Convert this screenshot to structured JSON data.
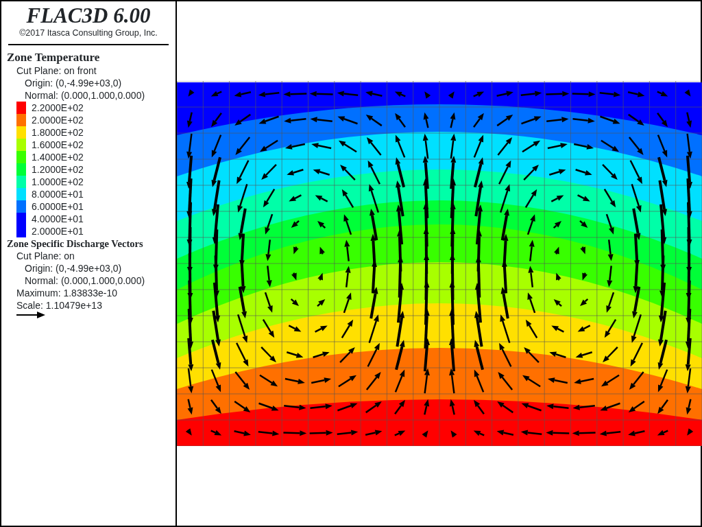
{
  "header": {
    "title": "FLAC3D 6.00",
    "copyright": "©2017 Itasca Consulting Group, Inc."
  },
  "legend": [
    {
      "kind": "contour",
      "title": "Zone Temperature",
      "cut_plane": {
        "label": "Cut Plane: on front",
        "children": [
          "Origin: (0,-4.99e+03,0)",
          "Normal: (0.000,1.000,0.000)"
        ]
      },
      "scale": [
        {
          "label": "2.2000E+02",
          "color": "#ff0000"
        },
        {
          "label": "2.0000E+02",
          "color": "#ff7000"
        },
        {
          "label": "1.8000E+02",
          "color": "#ffe000"
        },
        {
          "label": "1.6000E+02",
          "color": "#a8ff00"
        },
        {
          "label": "1.4000E+02",
          "color": "#38ff00"
        },
        {
          "label": "1.2000E+02",
          "color": "#00ff38"
        },
        {
          "label": "1.0000E+02",
          "color": "#00ffa8"
        },
        {
          "label": "8.0000E+01",
          "color": "#00e0ff"
        },
        {
          "label": "6.0000E+01",
          "color": "#0070ff"
        },
        {
          "label": "4.0000E+01",
          "color": "#0000ff"
        },
        {
          "label": "2.0000E+01",
          "color": "#0000ff"
        }
      ]
    },
    {
      "kind": "vectors",
      "title": "Zone Specific Discharge Vectors",
      "cut_plane": {
        "label": "Cut Plane: on",
        "children": [
          "Origin: (0,-4.99e+03,0)",
          "Normal: (0.000,1.000,0.000)"
        ]
      },
      "details": [
        "Maximum: 1.83833e-10",
        "Scale: 1.10479e+13"
      ]
    }
  ]
}
